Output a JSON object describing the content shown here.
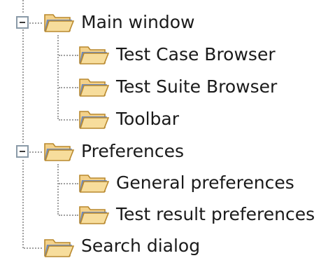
{
  "tree": {
    "nodes": [
      {
        "label": "Main window",
        "expanded": true,
        "icon": "folder-icon"
      },
      {
        "label": "Test Case Browser",
        "icon": "folder-icon"
      },
      {
        "label": "Test Suite Browser",
        "icon": "folder-icon"
      },
      {
        "label": "Toolbar",
        "icon": "folder-icon"
      },
      {
        "label": "Preferences",
        "expanded": true,
        "icon": "folder-icon"
      },
      {
        "label": "General preferences",
        "icon": "folder-icon"
      },
      {
        "label": "Test result preferences",
        "icon": "folder-icon"
      },
      {
        "label": "Search dialog",
        "icon": "folder-icon"
      }
    ]
  },
  "colors": {
    "folder_fill": "#f3d18a",
    "folder_front": "#f7dd9c",
    "folder_blue": "#5b7fc0",
    "folder_outline": "#b9892e",
    "connector": "#a0a0a0"
  }
}
